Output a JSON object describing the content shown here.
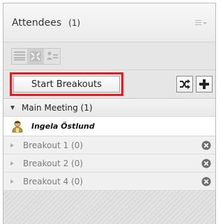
{
  "header": {
    "title": "Attendees",
    "count": "(1)"
  },
  "view_buttons": [
    {
      "icon": "list-view-icon"
    },
    {
      "icon": "breakout-view-icon"
    },
    {
      "icon": "status-view-icon"
    }
  ],
  "actions": {
    "start_label": "Start Breakouts",
    "highlight_color": "#e11d24",
    "shuffle_icon": "shuffle-icon",
    "add_icon": "plus-icon"
  },
  "main_meeting": {
    "label": "Main Meeting (1)",
    "attendees": [
      {
        "name": "Ingela Östlund",
        "icon": "host-avatar-icon"
      }
    ]
  },
  "breakouts": [
    {
      "label": "Breakout 1 (0)"
    },
    {
      "label": "Breakout 2 (0)"
    },
    {
      "label": "Breakout 4 (0)"
    }
  ]
}
